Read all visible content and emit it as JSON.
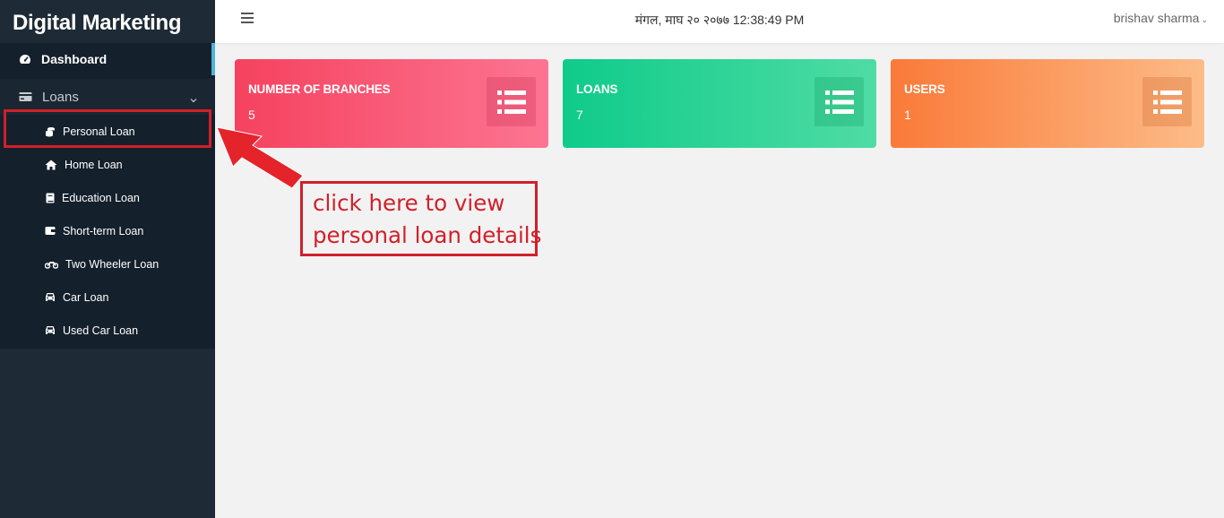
{
  "sidebar": {
    "brand": "Digital Marketing",
    "dashboard": {
      "label": "Dashboard",
      "icon": "speedometer-icon"
    },
    "loans": {
      "label": "Loans",
      "icon": "credit-card-icon"
    },
    "items": [
      {
        "label": "Personal Loan",
        "icon": "coins-icon"
      },
      {
        "label": "Home Loan",
        "icon": "home-icon"
      },
      {
        "label": "Education Loan",
        "icon": "book-icon"
      },
      {
        "label": "Short-term Loan",
        "icon": "wallet-icon"
      },
      {
        "label": "Two Wheeler Loan",
        "icon": "motorcycle-icon"
      },
      {
        "label": "Car Loan",
        "icon": "car-icon"
      },
      {
        "label": "Used Car Loan",
        "icon": "car-icon"
      }
    ]
  },
  "topbar": {
    "datetime": "मंगल, माघ २० २०७७ 12:38:49 PM",
    "user": "brishav sharma"
  },
  "cards": [
    {
      "title": "NUMBER OF BRANCHES",
      "value": "5",
      "color": "#f5425f"
    },
    {
      "title": "LOANS",
      "value": "7",
      "color": "#0fcb8a"
    },
    {
      "title": "USERS",
      "value": "1",
      "color": "#fa7a39"
    }
  ],
  "annotation": {
    "line1": "click here to view",
    "line2": "personal loan details",
    "color": "#d0202a"
  }
}
